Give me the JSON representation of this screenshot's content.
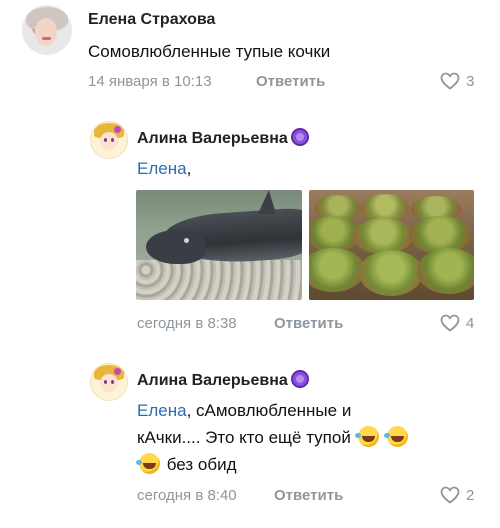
{
  "comments": [
    {
      "author": "Елена Страхова",
      "text": "Сомовлюбленные тупые кочки",
      "date": "14 января в 10:13",
      "reply_label": "Ответить",
      "likes": "3"
    },
    {
      "author": "Алина Валерьевна",
      "mention": "Елена",
      "text_after_mention": ",",
      "date": "сегодня в 8:38",
      "reply_label": "Ответить",
      "likes": "4"
    },
    {
      "author": "Алина Валерьевна",
      "mention": "Елена",
      "line1_rest": ", сАмовлюбленные и",
      "line2": "кАчки.... Это кто ещё тупой",
      "line3": "без обид",
      "date": "сегодня в 8:40",
      "reply_label": "Ответить",
      "likes": "2"
    }
  ],
  "icons": {
    "like": "heart-icon",
    "verified": "verified-badge-icon",
    "emoji": "rofl-emoji-icon"
  },
  "colors": {
    "mention": "#2a6cb3",
    "meta": "#8e969e",
    "text": "#111111"
  }
}
